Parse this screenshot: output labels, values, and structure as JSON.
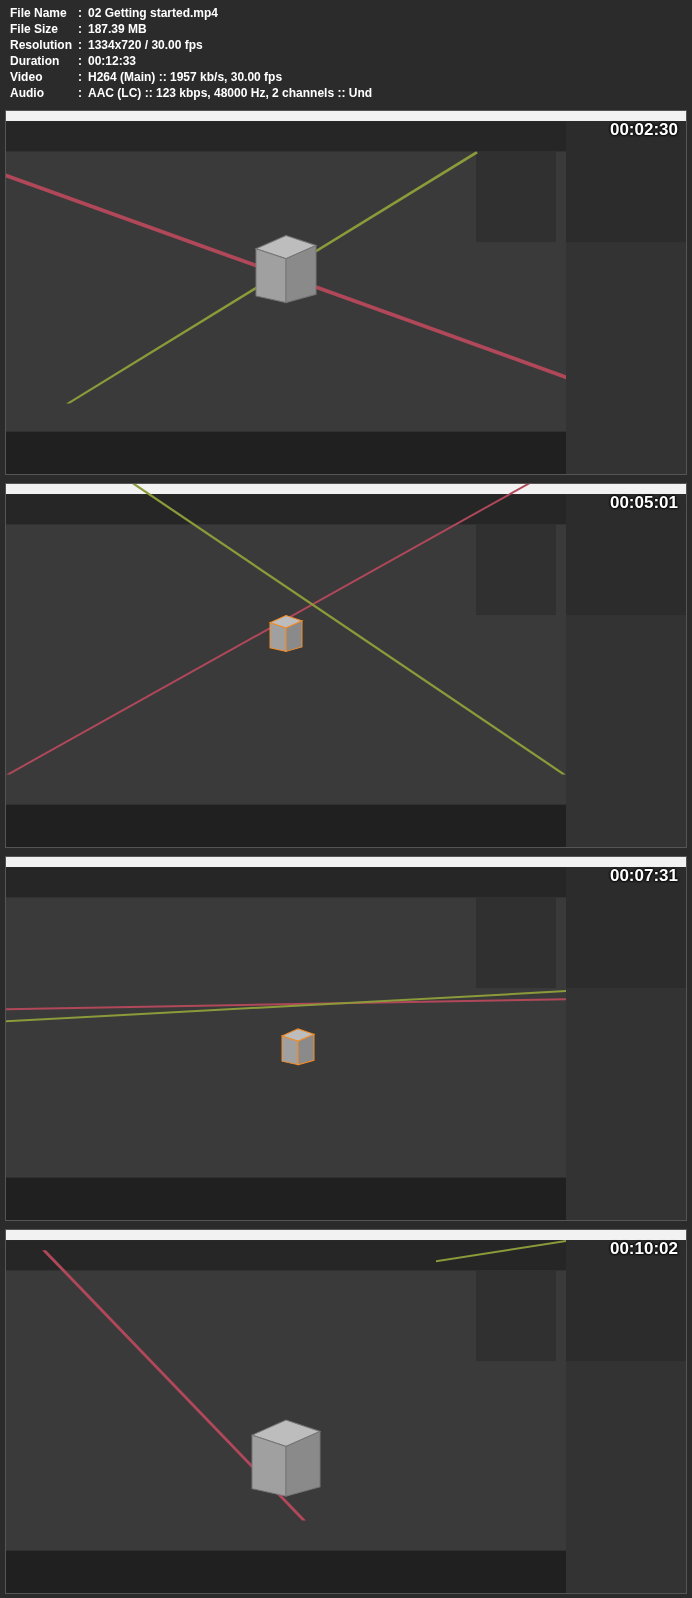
{
  "info": [
    {
      "label": "File Name",
      "separator": ":",
      "value": "02 Getting started.mp4"
    },
    {
      "label": "File Size",
      "separator": ":",
      "value": "187.39 MB"
    },
    {
      "label": "Resolution",
      "separator": ":",
      "value": "1334x720 / 30.00 fps"
    },
    {
      "label": "Duration",
      "separator": ":",
      "value": "00:12:33"
    },
    {
      "label": "Video",
      "separator": ":",
      "value": "H264 (Main) :: 1957 kb/s, 30.00 fps"
    },
    {
      "label": "Audio",
      "separator": ":",
      "value": "AAC (LC) :: 123 kbps, 48000 Hz, 2 channels :: Und"
    }
  ],
  "frames": [
    {
      "kind": "picture",
      "timestamp": "00:02:30"
    },
    {
      "kind": "picture",
      "timestamp": "00:05:01"
    },
    {
      "kind": "picture",
      "timestamp": "00:07:31"
    },
    {
      "kind": "picture",
      "timestamp": "00:10:02"
    }
  ]
}
